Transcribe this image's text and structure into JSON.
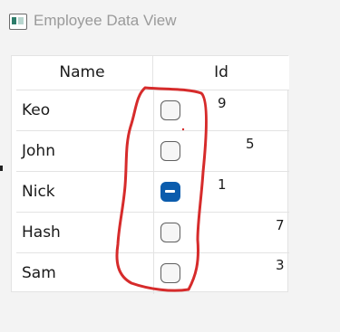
{
  "window": {
    "title": "Employee Data View"
  },
  "grid": {
    "columns": [
      "Name",
      "Id"
    ],
    "rows": [
      {
        "name": "Keo",
        "id": "9",
        "checkbox": "unchecked"
      },
      {
        "name": "John",
        "id": "5",
        "checkbox": "unchecked"
      },
      {
        "name": "Nick",
        "id": "1",
        "checkbox": "indeterminate"
      },
      {
        "name": "Hash",
        "id": "7",
        "checkbox": "unchecked"
      },
      {
        "name": "Sam",
        "id": "3",
        "checkbox": "unchecked"
      }
    ]
  },
  "colors": {
    "annotation": "#d62b2b",
    "checkbox_accent": "#0b5cad"
  }
}
